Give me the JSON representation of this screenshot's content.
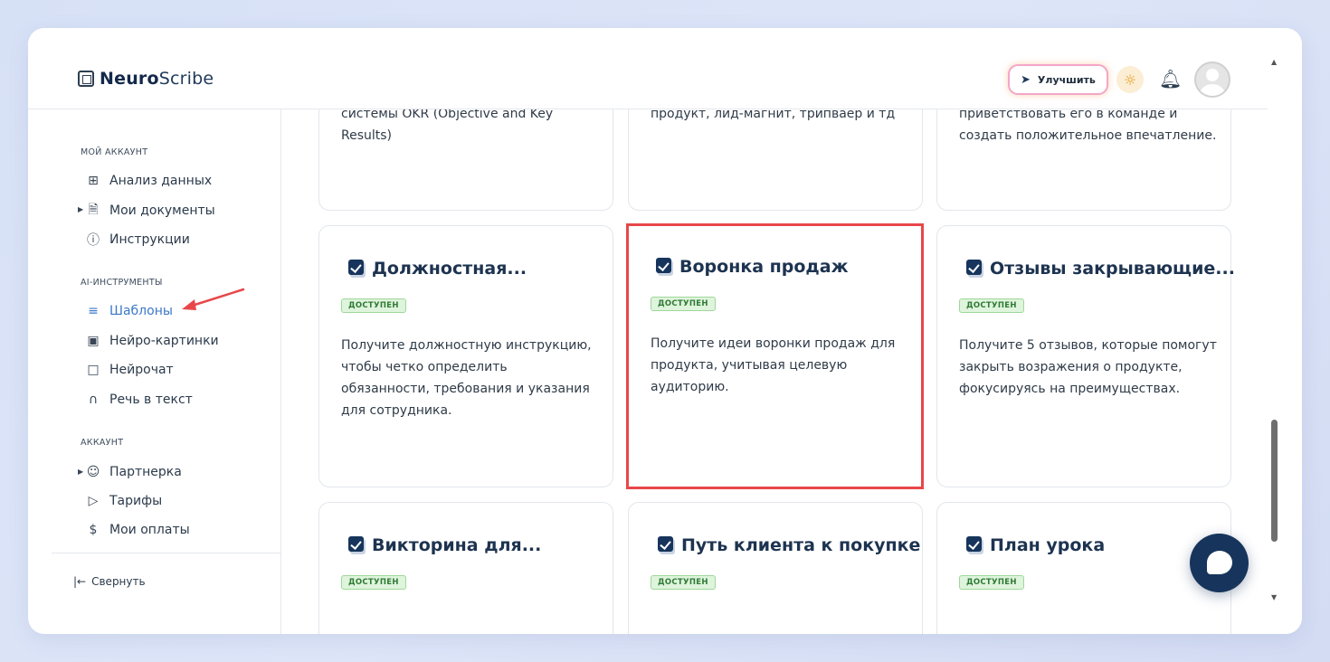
{
  "app": {
    "logo_bold": "Neuro",
    "logo_light": "Scribe"
  },
  "header": {
    "upgrade_label": "Улучшить"
  },
  "sidebar": {
    "section_account": "МОЙ АККАУНТ",
    "section_ai": "AI-ИНСТРУМЕНТЫ",
    "section_profile": "АККАУНТ",
    "items": [
      {
        "label": "Анализ данных",
        "icon": "grid-icon"
      },
      {
        "label": "Мои документы",
        "icon": "document-icon"
      },
      {
        "label": "Инструкции",
        "icon": "help-circle-icon"
      },
      {
        "label": "Шаблоны",
        "icon": "layers-icon",
        "active": true
      },
      {
        "label": "Нейро-картинки",
        "icon": "image-icon"
      },
      {
        "label": "Нейрочат",
        "icon": "chat-icon"
      },
      {
        "label": "Речь в текст",
        "icon": "headphones-icon"
      },
      {
        "label": "Партнерка",
        "icon": "users-icon"
      },
      {
        "label": "Тарифы",
        "icon": "tag-icon"
      },
      {
        "label": "Мои оплаты",
        "icon": "dollar-icon"
      }
    ],
    "collapse_label": "Свернуть"
  },
  "cards_top": [
    {
      "desc": "системы OKR (Objective and Key Results)"
    },
    {
      "desc": "продукт, лид-магнит, трипваер и тд"
    },
    {
      "desc": "приветствовать его в команде и создать положительное впечатление."
    }
  ],
  "cards_mid": [
    {
      "title": "Должностная...",
      "badge": "ДОСТУПЕН",
      "desc": "Получите должностную инструкцию, чтобы четко определить обязанности, требования и указания для сотрудника."
    },
    {
      "title": "Воронка продаж",
      "badge": "ДОСТУПЕН",
      "desc": "Получите идеи воронки продаж для продукта, учитывая целевую аудиторию."
    },
    {
      "title": "Отзывы закрывающие...",
      "badge": "ДОСТУПЕН",
      "desc": "Получите 5 отзывов, которые помогут закрыть возражения о продукте, фокусируясь на преимуществах."
    }
  ],
  "cards_bottom": [
    {
      "title": "Викторина для...",
      "badge": "ДОСТУПЕН"
    },
    {
      "title": "Путь клиента к покупке",
      "badge": "ДОСТУПЕН"
    },
    {
      "title": "План урока",
      "badge": "ДОСТУПЕН"
    }
  ],
  "colors": {
    "accent": "#3c78c9",
    "navy": "#17355c",
    "highlight": "#e8474a",
    "badge_green": "#2f7a36"
  }
}
